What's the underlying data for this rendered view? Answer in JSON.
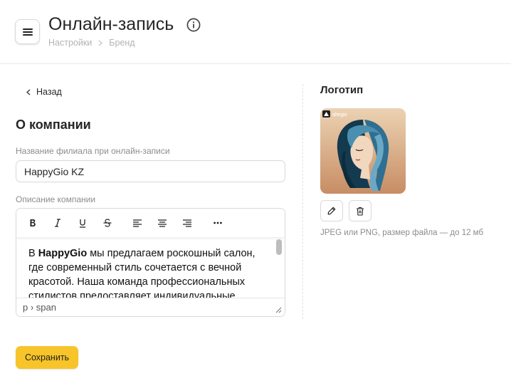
{
  "header": {
    "title": "Онлайн-запись",
    "breadcrumb": [
      "Настройки",
      "Бренд"
    ]
  },
  "back_label": "Назад",
  "section_title": "О компании",
  "branch_name": {
    "label": "Название филиала при онлайн-записи",
    "value": "HappyGio KZ"
  },
  "description": {
    "label": "Описание компании",
    "toolbar": [
      "bold",
      "italic",
      "underline",
      "strikethrough",
      "align-left",
      "align-center",
      "align-right",
      "more"
    ],
    "text_bold": "HappyGio",
    "text_before": "В ",
    "text_after": " мы предлагаем роскошный салон, где современный стиль сочетается с вечной красотой. Наша команда профессиональных стилистов предоставляет индивидуальные услуги.",
    "path": "p › span"
  },
  "save_label": "Сохранить",
  "logo": {
    "title": "Логотип",
    "brand_text": "altegio",
    "hint": "JPEG или PNG, размер файла — до 12 мб"
  },
  "colors": {
    "accent": "#f7c42a",
    "logo_bg_top": "#e9c9a8",
    "logo_bg_bottom": "#c98f66",
    "hair_dark": "#12364a",
    "hair_light": "#3d7ea0"
  }
}
